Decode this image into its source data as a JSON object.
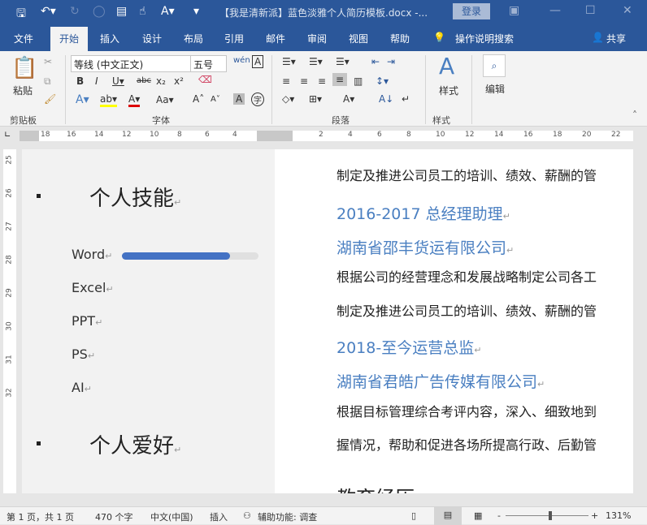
{
  "titlebar": {
    "title": "【我是清新派】蓝色淡雅个人简历模板.docx  -...",
    "login": "登录"
  },
  "menu": [
    "文件",
    "开始",
    "插入",
    "设计",
    "布局",
    "引用",
    "邮件",
    "审阅",
    "视图",
    "帮助"
  ],
  "search": "操作说明搜索",
  "share": "共享",
  "ribbon": {
    "paste": "粘贴",
    "font": "等线 (中文正文)",
    "size": "五号",
    "styles": "样式",
    "edit": "编辑",
    "groups": {
      "clipboard": "剪贴板",
      "font": "字体",
      "paragraph": "段落",
      "styles": "样式"
    }
  },
  "ruler": {
    "h": [
      "18",
      "16",
      "14",
      "12",
      "10",
      "8",
      "6",
      "4",
      "2",
      "4",
      "6",
      "8",
      "10",
      "12",
      "14",
      "16",
      "18",
      "20",
      "22"
    ],
    "v": [
      "25",
      "26",
      "27",
      "28",
      "29",
      "30",
      "31",
      "32"
    ]
  },
  "left": {
    "heading1": "个人技能",
    "heading2": "个人爱好",
    "skills": [
      {
        "name": "Word",
        "level": 0.79
      },
      {
        "name": "Excel"
      },
      {
        "name": "PPT"
      },
      {
        "name": "PS"
      },
      {
        "name": "AI"
      }
    ]
  },
  "right": [
    {
      "text": "制定及推进公司员工的培训、绩效、薪酬的管",
      "type": "body"
    },
    {
      "text": "2016-2017 总经理助理",
      "type": "blue"
    },
    {
      "text": "湖南省邵丰货运有限公司",
      "type": "blue"
    },
    {
      "text": "根据公司的经营理念和发展战略制定公司各工",
      "type": "body"
    },
    {
      "text": "制定及推进公司员工的培训、绩效、薪酬的管",
      "type": "body"
    },
    {
      "text": "2018-至今运营总监",
      "type": "blue"
    },
    {
      "text": "湖南省君皓广告传媒有限公司",
      "type": "blue"
    },
    {
      "text": "根据目标管理综合考评内容，深入、细致地到",
      "type": "body"
    },
    {
      "text": "握情况，帮助和促进各场所提高行政、后勤管",
      "type": "body"
    },
    {
      "text": "教育经历",
      "type": "heading"
    }
  ],
  "status": {
    "page": "第 1 页，共 1 页",
    "words": "470 个字",
    "lang": "中文(中国)",
    "mode": "插入",
    "access": "辅助功能: 调查",
    "zoom": "131%"
  },
  "paramark": "↵"
}
